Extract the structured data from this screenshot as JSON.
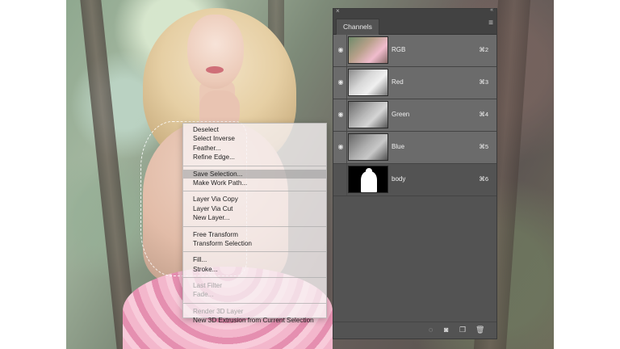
{
  "context_menu": {
    "groups": [
      [
        {
          "label": "Deselect",
          "state": "normal"
        },
        {
          "label": "Select Inverse",
          "state": "normal"
        },
        {
          "label": "Feather...",
          "state": "normal"
        },
        {
          "label": "Refine Edge...",
          "state": "normal"
        }
      ],
      [
        {
          "label": "Save Selection...",
          "state": "highlighted"
        },
        {
          "label": "Make Work Path...",
          "state": "normal"
        }
      ],
      [
        {
          "label": "Layer Via Copy",
          "state": "normal"
        },
        {
          "label": "Layer Via Cut",
          "state": "normal"
        },
        {
          "label": "New Layer...",
          "state": "normal"
        }
      ],
      [
        {
          "label": "Free Transform",
          "state": "normal"
        },
        {
          "label": "Transform Selection",
          "state": "normal"
        }
      ],
      [
        {
          "label": "Fill...",
          "state": "normal"
        },
        {
          "label": "Stroke...",
          "state": "normal"
        }
      ],
      [
        {
          "label": "Last Filter",
          "state": "disabled"
        },
        {
          "label": "Fade...",
          "state": "disabled"
        }
      ],
      [
        {
          "label": "Render 3D Layer",
          "state": "disabled"
        },
        {
          "label": "New 3D Extrusion from Current Selection",
          "state": "normal"
        }
      ]
    ]
  },
  "channels_panel": {
    "tab_label": "Channels",
    "close_glyph": "×",
    "collapse_glyph": "«",
    "menu_icon": "panel-menu-icon",
    "channels": [
      {
        "name": "RGB",
        "shortcut": "⌘2",
        "visible": true,
        "thumb": "rgb"
      },
      {
        "name": "Red",
        "shortcut": "⌘3",
        "visible": true,
        "thumb": "red"
      },
      {
        "name": "Green",
        "shortcut": "⌘4",
        "visible": true,
        "thumb": "green"
      },
      {
        "name": "Blue",
        "shortcut": "⌘5",
        "visible": true,
        "thumb": "blue"
      },
      {
        "name": "body",
        "shortcut": "⌘6",
        "visible": false,
        "thumb": "body"
      }
    ],
    "footer_icons": [
      "load-selection-icon",
      "save-selection-icon",
      "new-channel-icon",
      "delete-channel-icon"
    ]
  },
  "colors": {
    "panel_bg": "#535353",
    "selected_row": "#6b6b6b",
    "menu_highlight": "#969696"
  }
}
